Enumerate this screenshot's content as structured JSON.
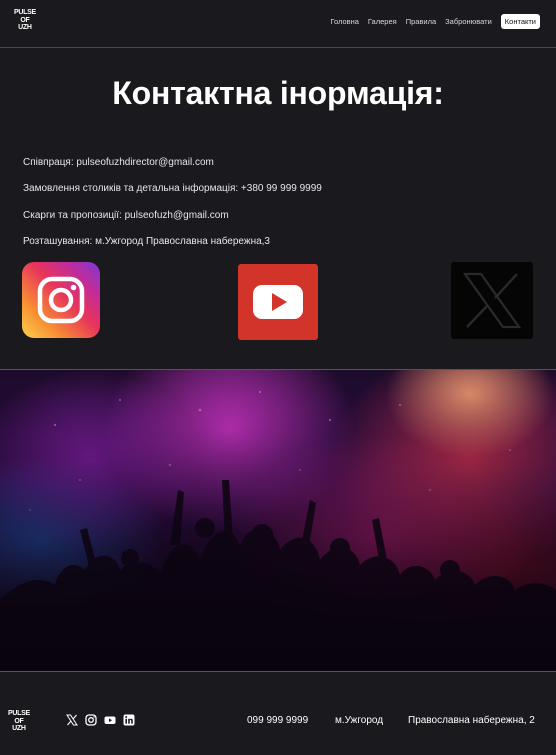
{
  "header": {
    "logo_lines": [
      "PULSE",
      "OF",
      "UZH"
    ],
    "nav": [
      {
        "label": "Головна",
        "active": false
      },
      {
        "label": "Галерея",
        "active": false
      },
      {
        "label": "Правила",
        "active": false
      },
      {
        "label": "Забронювати",
        "active": false
      },
      {
        "label": "Контакти",
        "active": true
      }
    ]
  },
  "contact": {
    "title": "Контактна інормація:",
    "lines": [
      "Співпраця: pulseofuzhdirector@gmail.com",
      "Замовлення столиків та детальна інформація: +380 99 999 9999",
      "Скарги та пропозиції: pulseofuzh@gmail.com",
      "Розташування: м.Ужгород Православна набережна,3"
    ],
    "socials": [
      "instagram-icon",
      "youtube-icon",
      "x-icon"
    ]
  },
  "colors": {
    "background": "#1a191d",
    "youtube": "#d3342a",
    "x_tile": "#050505",
    "active_nav_bg": "#ffffff"
  },
  "footer": {
    "logo_lines": [
      "PULSE",
      "OF",
      "UZH"
    ],
    "socials": [
      "x-icon",
      "instagram-icon",
      "youtube-icon",
      "linkedin-icon"
    ],
    "phone": "099 999 9999",
    "city": "м.Ужгород",
    "street": "Православна набережна, 2"
  }
}
